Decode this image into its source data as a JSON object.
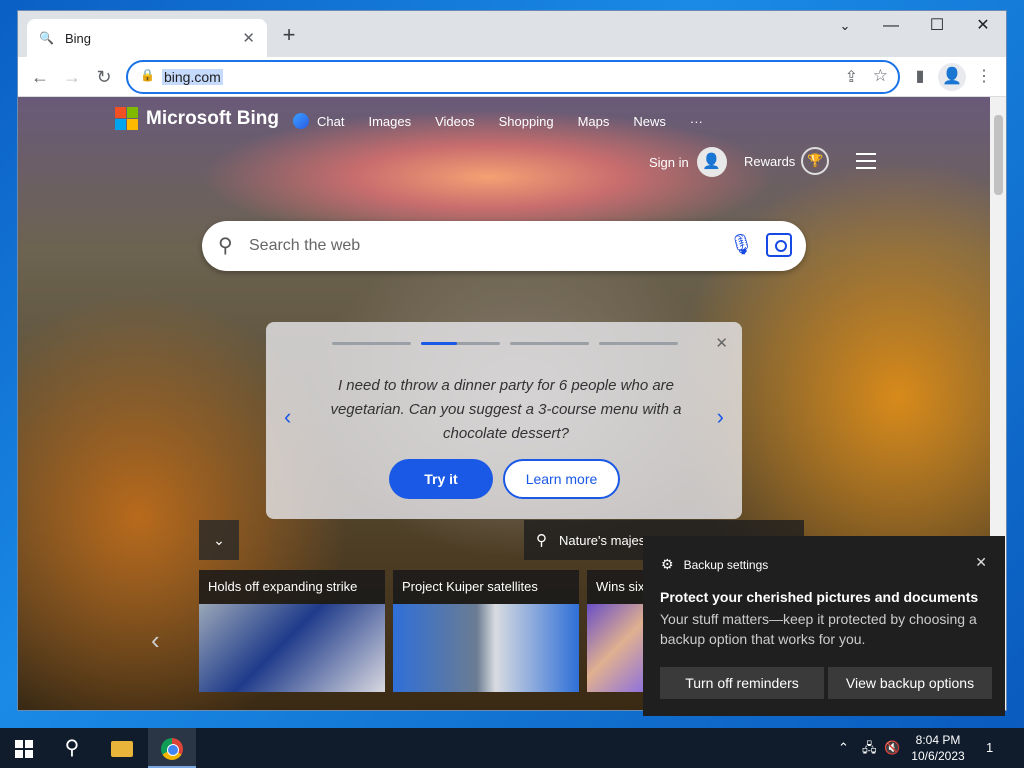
{
  "browser": {
    "tab_title": "Bing",
    "url": "bing.com",
    "window_controls": {
      "minimize": "—",
      "maximize": "☐",
      "close": "✕"
    }
  },
  "bing": {
    "logo_text": "Microsoft Bing",
    "nav": [
      "Chat",
      "Images",
      "Videos",
      "Shopping",
      "Maps",
      "News",
      "···"
    ],
    "sign_in": "Sign in",
    "rewards": "Rewards",
    "search_placeholder": "Search the web",
    "promo": {
      "message": "I need to throw a dinner party for 6 people who are vegetarian. Can you suggest a 3-course menu with a chocolate dessert?",
      "try_label": "Try it",
      "learn_label": "Learn more",
      "active_step": 2,
      "step_count": 4
    },
    "image_info": "Nature's majes",
    "news_cards": [
      {
        "title": "Holds off expanding strike",
        "image_colors": [
          "#9aa7b8",
          "#1f3b8a",
          "#d8d8e0"
        ]
      },
      {
        "title": "Project Kuiper satellites",
        "image_colors": [
          "#2f6fd8",
          "#d8dbe0",
          "#6b7c93"
        ]
      },
      {
        "title": "Wins sixt",
        "image_colors": [
          "#6a4fc6",
          "#e0b090",
          "#8b6fe0"
        ]
      }
    ]
  },
  "notification": {
    "app": "Backup settings",
    "title": "Protect your cherished pictures and documents",
    "body": "Your stuff matters—keep it protected by choosing a backup option that works for you.",
    "button_primary": "Turn off reminders",
    "button_secondary": "View backup options"
  },
  "taskbar": {
    "time": "8:04 PM",
    "date": "10/6/2023",
    "notification_count": "1"
  },
  "colors": {
    "accent": "#1a58e6",
    "ms_red": "#f25022",
    "ms_green": "#7fba00",
    "ms_blue": "#00a4ef",
    "ms_yellow": "#ffb900"
  }
}
